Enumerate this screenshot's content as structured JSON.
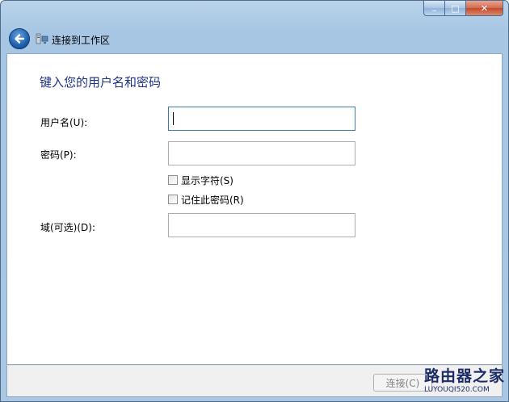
{
  "window": {
    "caption_buttons": {
      "minimize_glyph": "–",
      "maximize_glyph": "□",
      "close_glyph": "✕"
    }
  },
  "nav": {
    "title": "连接到工作区",
    "back_icon": "back-arrow-icon",
    "title_icon": "network-workplace-icon"
  },
  "form": {
    "heading": "键入您的用户名和密码",
    "username_label": "用户名(U):",
    "username_value": "",
    "password_label": "密码(P):",
    "password_value": "",
    "show_chars_label": "显示字符(S)",
    "show_chars_checked": false,
    "remember_label": "记住此密码(R)",
    "remember_checked": false,
    "domain_label": "域(可选)(D):",
    "domain_value": ""
  },
  "footer": {
    "connect_label": "连接(C)"
  },
  "watermark": {
    "line1": "路由器之家",
    "line2": "LUYOUQI520.COM"
  },
  "colors": {
    "heading": "#1e3287",
    "frame": "#a9c7e2",
    "close_button": "#c44a2c"
  }
}
